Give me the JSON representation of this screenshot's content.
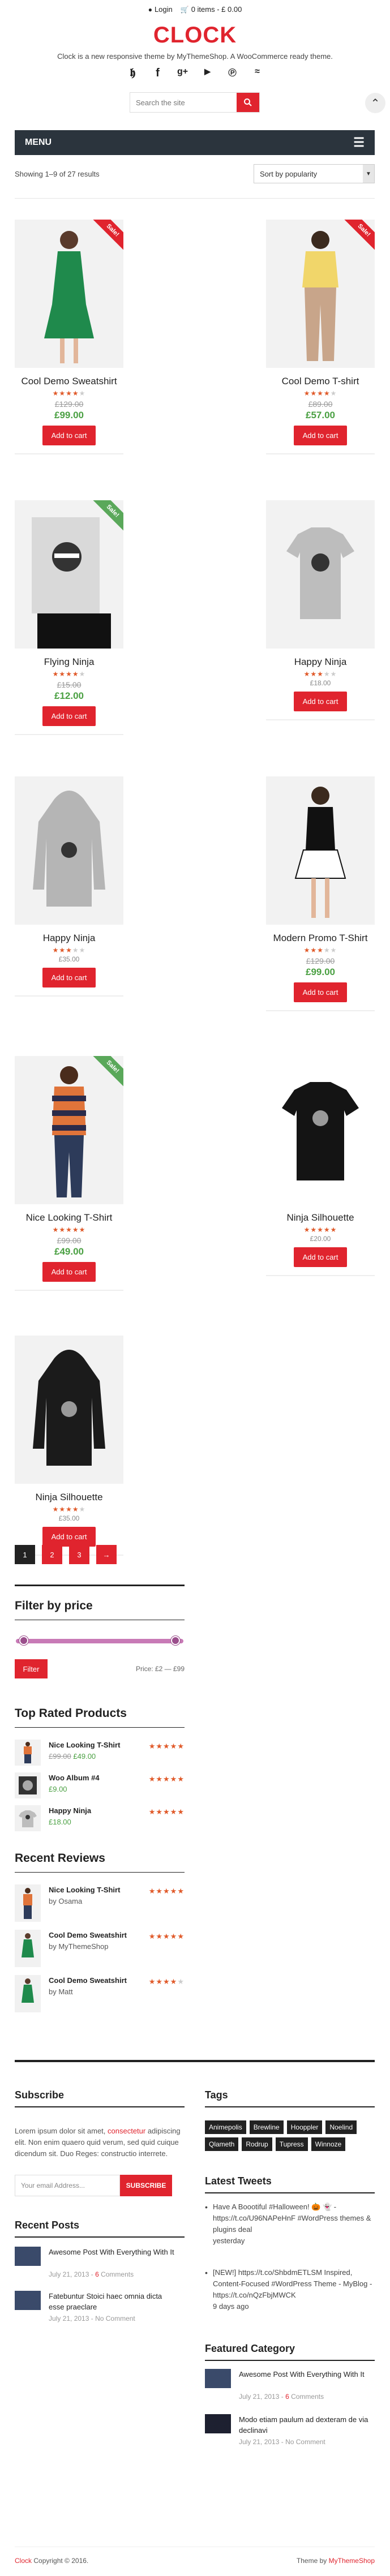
{
  "topbar": {
    "login": "Login",
    "cart": "0 items - £  0.00"
  },
  "site": {
    "title": "CLOCK",
    "tagline": "Clock is a new responsive theme by MyThemeShop. A WooCommerce ready theme."
  },
  "social": [
    "twitter-icon",
    "facebook-icon",
    "googleplus-icon",
    "youtube-icon",
    "pinterest-icon",
    "rss-icon"
  ],
  "search": {
    "placeholder": "Search the site"
  },
  "menu": {
    "label": "MENU"
  },
  "shop": {
    "result_count": "Showing 1–9 of 27 results",
    "sort": "Sort by popularity",
    "sale_label": "Sale!",
    "add_to_cart": "Add to cart"
  },
  "products": [
    {
      "name": "Cool Demo Sweatshirt",
      "stars": 4,
      "old": "£129.00",
      "price": "£99.00",
      "sale": true,
      "color": "red"
    },
    {
      "name": "Cool Demo T-shirt",
      "stars": 4,
      "old": "£89.00",
      "price": "£57.00",
      "sale": true,
      "color": "red"
    },
    {
      "name": "Flying Ninja",
      "stars": 4,
      "old": "£15.00",
      "price": "£12.00",
      "sale": true,
      "color": "green"
    },
    {
      "name": "Happy Ninja",
      "stars": 3,
      "old": "",
      "price": "£18.00",
      "sale": false
    },
    {
      "name": "Happy Ninja",
      "stars": 3,
      "old": "",
      "price": "£35.00",
      "sale": false
    },
    {
      "name": "Modern Promo T-Shirt",
      "stars": 3,
      "old": "£129.00",
      "price": "£99.00",
      "sale": false
    },
    {
      "name": "Nice Looking T-Shirt",
      "stars": 5,
      "old": "£99.00",
      "price": "£49.00",
      "sale": true,
      "color": "green"
    },
    {
      "name": "Ninja Silhouette",
      "stars": 5,
      "old": "",
      "price": "£20.00",
      "sale": false
    },
    {
      "name": "Ninja Silhouette",
      "stars": 4,
      "old": "",
      "price": "£35.00",
      "sale": false
    }
  ],
  "pagination": [
    "1",
    "2",
    "3",
    "→"
  ],
  "filter": {
    "title": "Filter by price",
    "button": "Filter",
    "range": "Price: £2 — £99",
    "min_fraction": 0.02,
    "max_fraction": 0.98
  },
  "top_rated": {
    "title": "Top Rated Products",
    "items": [
      {
        "name": "Nice Looking T-Shirt",
        "old": "£99.00",
        "price": "£49.00",
        "stars": 5
      },
      {
        "name": "Woo Album #4",
        "old": "",
        "price": "£9.00",
        "stars": 5
      },
      {
        "name": "Happy Ninja",
        "old": "",
        "price": "£18.00",
        "stars": 5
      }
    ]
  },
  "recent_reviews": {
    "title": "Recent Reviews",
    "items": [
      {
        "name": "Nice Looking T-Shirt",
        "by": "by Osama",
        "stars": 5
      },
      {
        "name": "Cool Demo Sweatshirt",
        "by": "by MyThemeShop",
        "stars": 5
      },
      {
        "name": "Cool Demo Sweatshirt",
        "by": "by Matt",
        "stars": 4
      }
    ]
  },
  "subscribe": {
    "title": "Subscribe",
    "text_before": "Lorem ipsum dolor sit amet, ",
    "text_link": "consectetur",
    "text_after": " adipiscing elit. Non enim quaero quid verum, sed quid cuique dicendum sit. Duo Reges: constructio interrete.",
    "placeholder": "Your email Address...",
    "button": "SUBSCRIBE"
  },
  "recent_posts": {
    "title": "Recent Posts",
    "items": [
      {
        "title": "Awesome Post With Everything With It",
        "date": "July 21, 2013 - ",
        "comments": "6",
        "comments_label": " Comments"
      },
      {
        "title": "Fatebuntur Stoici haec omnia dicta esse praeclare",
        "date": "July 21, 2013 - ",
        "comments": "No Comment",
        "comments_label": ""
      }
    ]
  },
  "tags": {
    "title": "Tags",
    "items": [
      "Animepolis",
      "Brewline",
      "Hooppler",
      "Noelind",
      "Qlameth",
      "Rodrup",
      "Tupress",
      "Winnoze"
    ]
  },
  "tweets": {
    "title": "Latest Tweets",
    "items": [
      {
        "text": "Have A Boootiful #Halloween! 🎃 👻 - https://t.co/U96NAPeHnF #WordPress themes & plugins deal",
        "time": "yesterday"
      },
      {
        "text": "[NEW!] https://t.co/ShbdmETLSM Inspired, Content-Focused #WordPress Theme - MyBlog - https://t.co/nQzFbjMWCK",
        "time": "9 days ago"
      }
    ]
  },
  "featured": {
    "title": "Featured Category",
    "items": [
      {
        "title": "Awesome Post With Everything With It",
        "date": "July 21, 2013 - ",
        "comments": "6",
        "comments_label": " Comments"
      },
      {
        "title": "Modo etiam paulum ad dexteram de via declinavi",
        "date": "July 21, 2013 - ",
        "comments": "No Comment",
        "comments_label": ""
      }
    ]
  },
  "footer": {
    "brand": "Clock",
    "copyright": " Copyright © 2016.",
    "theme_prefix": "Theme by ",
    "theme_link": "MyThemeShop"
  }
}
